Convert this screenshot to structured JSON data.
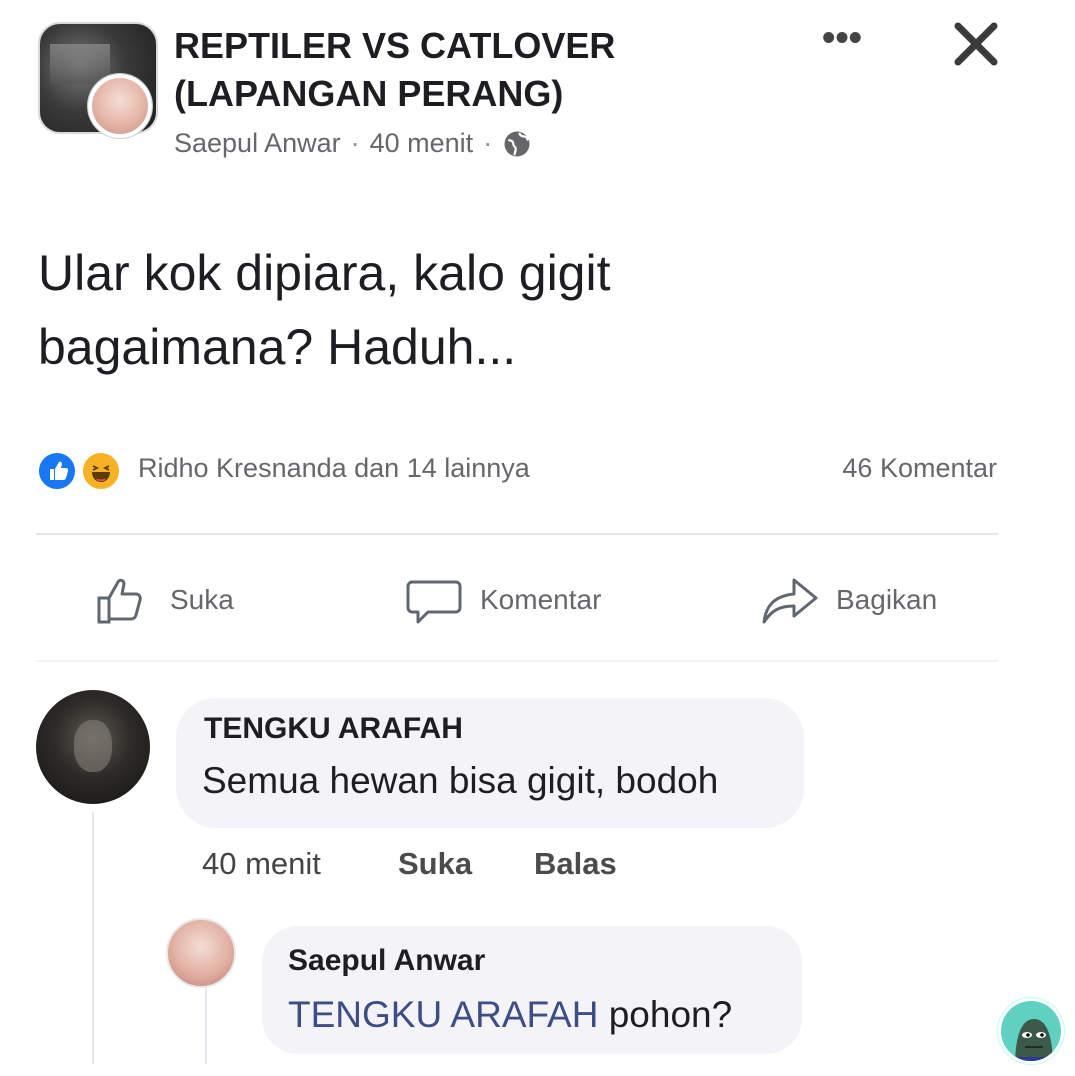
{
  "header": {
    "group_title": "REPTILER VS CATLOVER (LAPANGAN PERANG)",
    "author": "Saepul Anwar",
    "separator": "·",
    "time": "40 menit",
    "more_label": "•••",
    "privacy_icon": "globe-icon",
    "close_icon": "close-icon"
  },
  "post": {
    "text": "Ular kok dipiara, kalo gigit bagaimana? Haduh..."
  },
  "reactions": {
    "icons": [
      "like-reaction-icon",
      "haha-reaction-icon"
    ],
    "summary": "Ridho Kresnanda dan 14 lainnya",
    "comment_count": "46 Komentar"
  },
  "actions": {
    "like_label": "Suka",
    "comment_label": "Komentar",
    "share_label": "Bagikan"
  },
  "comments": [
    {
      "author": "TENGKU ARAFAH",
      "text": "Semua hewan bisa gigit, bodoh",
      "time": "40 menit",
      "like_label": "Suka",
      "reply_label": "Balas"
    }
  ],
  "reply": {
    "author": "Saepul Anwar",
    "mention": "TENGKU ARAFAH",
    "text": " pohon?"
  },
  "colors": {
    "accent": "#1877f2",
    "haha": "#f7b125",
    "muted": "#65676b",
    "bubble": "#f4f4f8"
  }
}
